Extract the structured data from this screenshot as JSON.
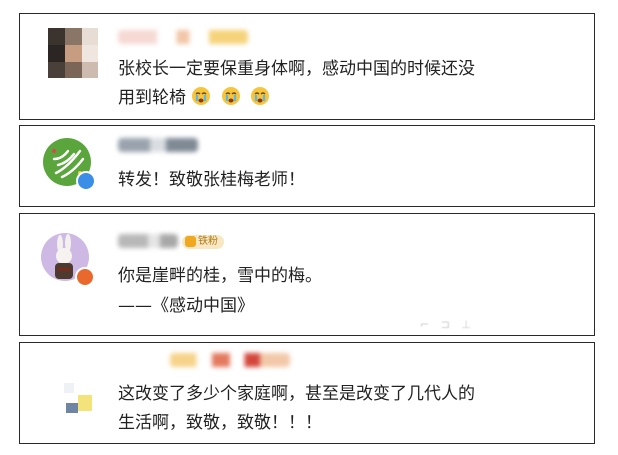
{
  "comments": [
    {
      "text_lines": [
        "张校长一定要保重身体啊，感动中国的时候还没",
        "用到轮椅"
      ],
      "emoji": "crying-face"
    },
    {
      "text_lines": [
        "转发！致敬张桂梅老师！"
      ],
      "verified_color": "#3b8ee8"
    },
    {
      "text_lines": [
        "你是崖畔的桂，雪中的梅。",
        "——《感动中国》"
      ],
      "badge_label": "铁粉",
      "verified_color": "#e8692b"
    },
    {
      "text_lines": [
        "这改变了多少个家庭啊，甚至是改变了几代人的",
        "生活啊，致敬，致敬！！！"
      ]
    }
  ],
  "colors": {
    "border": "#2a2a2a",
    "text": "#222222",
    "badge_bg": "#f7e8c3",
    "badge_text": "#b07a1a"
  }
}
